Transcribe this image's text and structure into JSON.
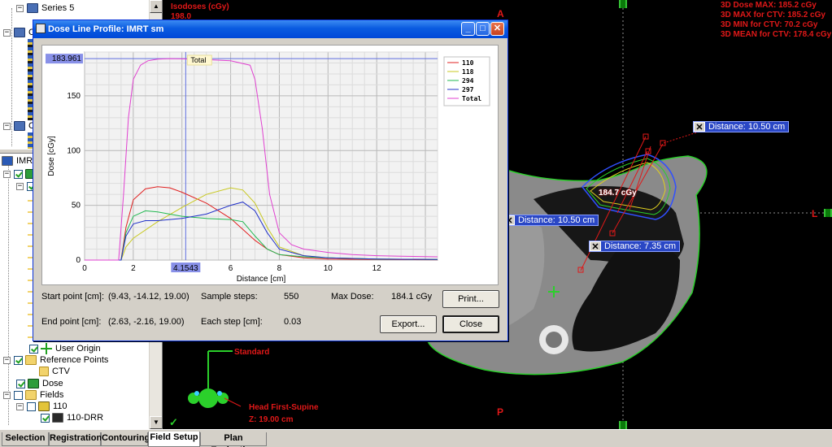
{
  "tree_top": {
    "items": [
      {
        "label": "Series 5"
      },
      {
        "label": "C"
      },
      {
        "label": "C"
      }
    ]
  },
  "tree_bottom": {
    "root_label": "IMRT",
    "items": [
      {
        "label": "User Origin"
      },
      {
        "label": "Reference Points"
      },
      {
        "label": "CTV"
      },
      {
        "label": "Dose"
      },
      {
        "label": "Fields"
      },
      {
        "label": "110"
      },
      {
        "label": "110-DRR"
      }
    ]
  },
  "viewport": {
    "isodoses_title": "Isodoses (cGy)",
    "isodoses_value": "198.0",
    "stats": [
      "3D Dose MAX: 185.2 cGy",
      "3D MAX for CTV: 185.2 cGy",
      "3D MIN for CTV: 70.2 cGy",
      "3D MEAN for CTV: 178.4 cGy"
    ],
    "orientation_anterior": "A",
    "orientation_posterior": "P",
    "orientation_left": "L",
    "dose_point_label": "184.7 cGy",
    "distance_labels": [
      "Distance: 10.50 cm",
      "Distance: 10.50 cm",
      "Distance: 7.35 cm"
    ],
    "close_glyph": "✕",
    "patient_label_standard": "Standard",
    "patient_position": "Head First-Supine",
    "z_position": "Z: 19.00 cm"
  },
  "dialog": {
    "title": "Dose Line Profile: IMRT sm",
    "minimize_glyph": "_",
    "maximize_glyph": "□",
    "close_glyph": "✕",
    "start_point_label": "Start point [cm]:",
    "start_point_value": "(9.43, -14.12, 19.00)",
    "end_point_label": "End point [cm]:",
    "end_point_value": "(2.63, -2.16, 19.00)",
    "sample_steps_label": "Sample steps:",
    "sample_steps_value": "550",
    "each_step_label": "Each step [cm]:",
    "each_step_value": "0.03",
    "max_dose_label": "Max Dose:",
    "max_dose_value": "184.1 cGy",
    "print_label": "Print...",
    "export_label": "Export...",
    "close_label": "Close"
  },
  "chart_data": {
    "type": "line",
    "xlabel": "Distance [cm]",
    "ylabel": "Dose [cGy]",
    "xlim": [
      0,
      14.5
    ],
    "ylim": [
      0,
      190
    ],
    "x_ticks": [
      0,
      2,
      4,
      6,
      8,
      10,
      12
    ],
    "y_ticks": [
      0,
      50,
      100,
      150
    ],
    "cursor_x": 4.1543,
    "cursor_x_label": "4.1543",
    "cursor_y": 183.961,
    "cursor_y_label": "183.961",
    "total_annotation": "Total",
    "grid": true,
    "legend_position": "top-right",
    "series": [
      {
        "name": "110",
        "color": "#e02020",
        "x": [
          0,
          1.5,
          1.7,
          2.0,
          2.5,
          3.0,
          3.5,
          4.0,
          5.0,
          6.0,
          6.5,
          7.0,
          7.5,
          8.0,
          9.0,
          10.0,
          12.0,
          14.5
        ],
        "y": [
          0,
          0,
          30,
          55,
          65,
          67,
          66,
          62,
          52,
          38,
          28,
          18,
          10,
          5,
          2,
          1,
          0.5,
          0.3
        ]
      },
      {
        "name": "118",
        "color": "#c8c820",
        "x": [
          0,
          1.5,
          1.7,
          2.0,
          3.0,
          4.0,
          5.0,
          6.0,
          6.5,
          7.0,
          7.5,
          8.0,
          9.0,
          10.0,
          12.0,
          14.5
        ],
        "y": [
          0,
          0,
          12,
          20,
          35,
          48,
          60,
          66,
          64,
          52,
          30,
          12,
          4,
          2,
          1,
          0.5
        ]
      },
      {
        "name": "294",
        "color": "#20b850",
        "x": [
          0,
          1.5,
          1.7,
          2.0,
          2.5,
          3.0,
          4.0,
          5.0,
          6.0,
          6.5,
          7.0,
          7.5,
          8.0,
          9.0,
          10.0,
          12.0,
          14.5
        ],
        "y": [
          0,
          0,
          25,
          40,
          45,
          44,
          40,
          38,
          37,
          35,
          22,
          10,
          5,
          3,
          2,
          1,
          0.5
        ]
      },
      {
        "name": "297",
        "color": "#2030c8",
        "x": [
          0,
          1.5,
          1.7,
          2.0,
          2.5,
          3.0,
          4.0,
          5.0,
          6.0,
          6.5,
          7.0,
          7.5,
          8.0,
          9.0,
          10.0,
          12.0,
          14.5
        ],
        "y": [
          0,
          0,
          22,
          33,
          36,
          36,
          38,
          42,
          50,
          53,
          45,
          25,
          10,
          4,
          2,
          1,
          0.5
        ]
      },
      {
        "name": "Total",
        "color": "#e040d0",
        "x": [
          0,
          1.4,
          1.6,
          1.8,
          2.0,
          2.3,
          2.6,
          3.0,
          3.5,
          4.0,
          5.0,
          6.0,
          6.8,
          7.0,
          7.3,
          7.6,
          8.0,
          8.5,
          9.0,
          10.0,
          11.0,
          12.0,
          13.0,
          14.5
        ],
        "y": [
          0,
          0,
          60,
          130,
          165,
          178,
          182,
          183.5,
          184,
          183.8,
          183,
          182,
          178,
          165,
          120,
          60,
          25,
          14,
          10,
          7,
          5,
          4,
          3.5,
          3
        ]
      }
    ]
  },
  "tabs": [
    {
      "label": "Selection",
      "active": false
    },
    {
      "label": "Registration",
      "active": false
    },
    {
      "label": "Contouring",
      "active": false
    },
    {
      "label": "Field Setup",
      "active": true
    },
    {
      "label": "Plan Evaluation",
      "active": false
    }
  ]
}
